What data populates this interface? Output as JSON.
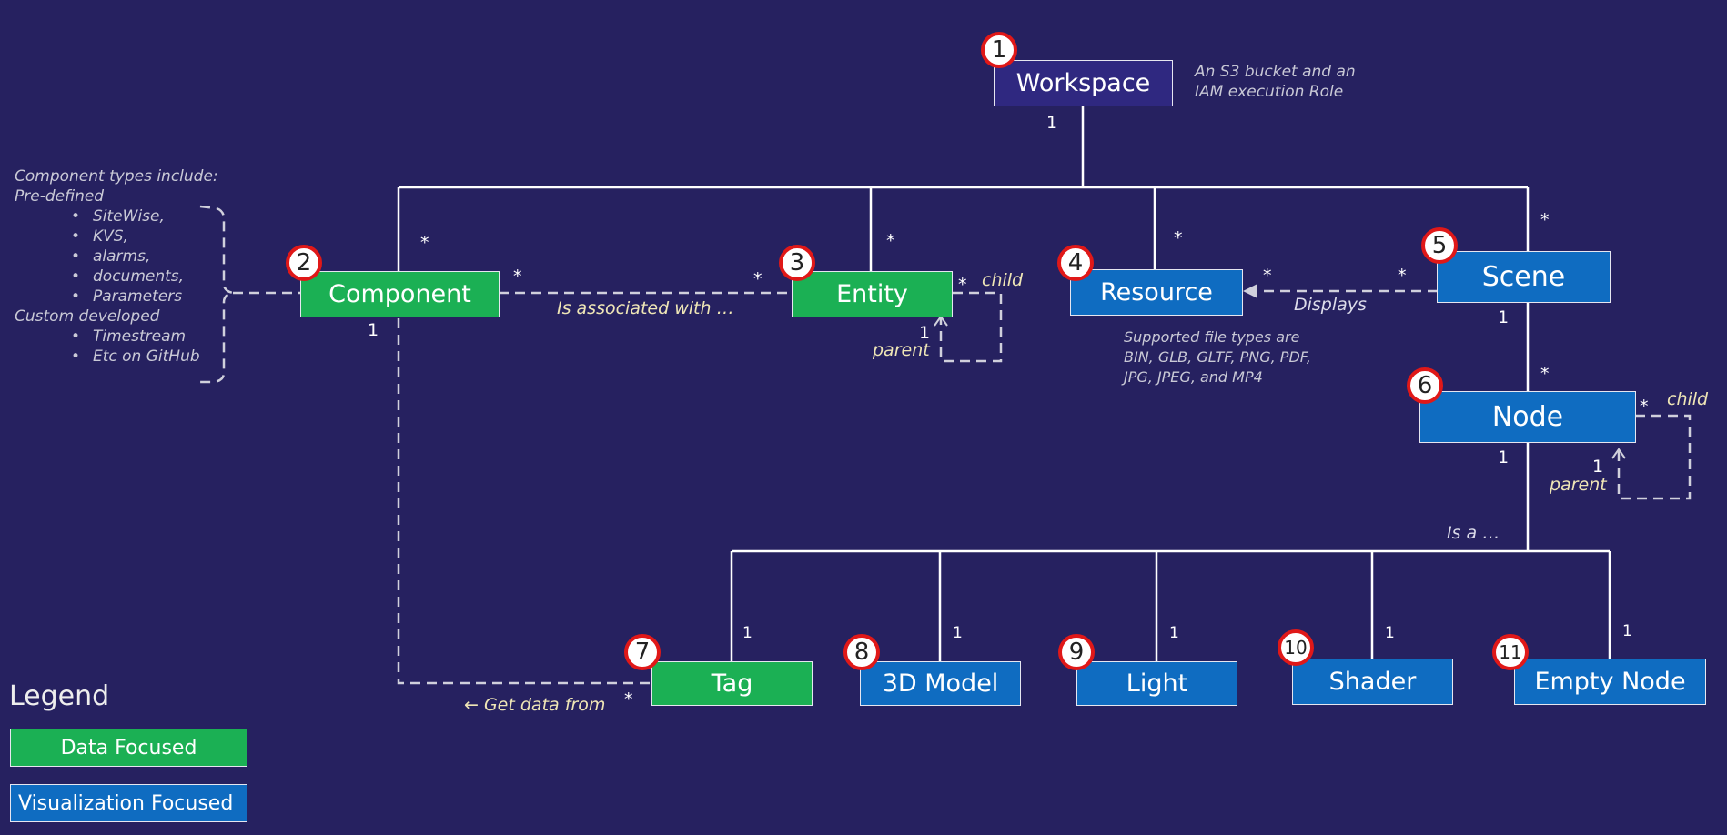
{
  "entities": {
    "workspace": {
      "number": "1",
      "label": "Workspace",
      "category": "other"
    },
    "component": {
      "number": "2",
      "label": "Component",
      "category": "data"
    },
    "entity": {
      "number": "3",
      "label": "Entity",
      "category": "data"
    },
    "resource": {
      "number": "4",
      "label": "Resource",
      "category": "visualization"
    },
    "scene": {
      "number": "5",
      "label": "Scene",
      "category": "visualization"
    },
    "node": {
      "number": "6",
      "label": "Node",
      "category": "visualization"
    },
    "tag": {
      "number": "7",
      "label": "Tag",
      "category": "data"
    },
    "model3d": {
      "number": "8",
      "label": "3D Model",
      "category": "visualization"
    },
    "light": {
      "number": "9",
      "label": "Light",
      "category": "visualization"
    },
    "shader": {
      "number": "10",
      "label": "Shader",
      "category": "visualization"
    },
    "empty_node": {
      "number": "11",
      "label": "Empty Node",
      "category": "visualization"
    }
  },
  "multiplicities": {
    "workspace_bottom": "1",
    "component_top": "*",
    "entity_top": "*",
    "resource_top": "*",
    "scene_top": "*",
    "component_right": "*",
    "entity_left": "*",
    "entity_child": "*",
    "entity_parent": "1",
    "resource_right": "*",
    "scene_left": "*",
    "component_bottom": "1",
    "scene_bottom": "1",
    "node_top": "*",
    "node_child": "*",
    "node_parent": "1",
    "node_bottom": "1",
    "tag_top": "1",
    "model3d_top": "1",
    "light_top": "1",
    "shader_top": "1",
    "empty_node_top": "1",
    "tag_left": "*"
  },
  "relation_labels": {
    "associated": "Is associated with …",
    "displays": "Displays",
    "entity_child": "child",
    "entity_parent": "parent",
    "node_child": "child",
    "node_parent": "parent",
    "is_a": "Is a …",
    "get_data": "← Get data from"
  },
  "notes": {
    "workspace": [
      "An S3 bucket and an",
      "IAM execution Role"
    ],
    "resource": [
      "Supported file types are",
      "BIN, GLB, GLTF, PNG, PDF,",
      "JPG, JPEG, and MP4"
    ],
    "component_types": {
      "heading": "Component types include:",
      "predefined_label": "Pre-defined",
      "predefined": [
        "SiteWise,",
        "KVS,",
        "alarms,",
        "documents,",
        "Parameters"
      ],
      "custom_label": "Custom developed",
      "custom": [
        "Timestream",
        "Etc on GitHub"
      ]
    }
  },
  "legend": {
    "title": "Legend",
    "items": [
      {
        "label": "Data Focused",
        "color": "#1bb054"
      },
      {
        "label": "Visualization Focused",
        "color": "#0f6cc1"
      }
    ]
  },
  "colors": {
    "background": "#262160",
    "data": "#1bb054",
    "visualization": "#0f6cc1",
    "workspace": "#2f2880",
    "badge_ring": "#e01818"
  }
}
